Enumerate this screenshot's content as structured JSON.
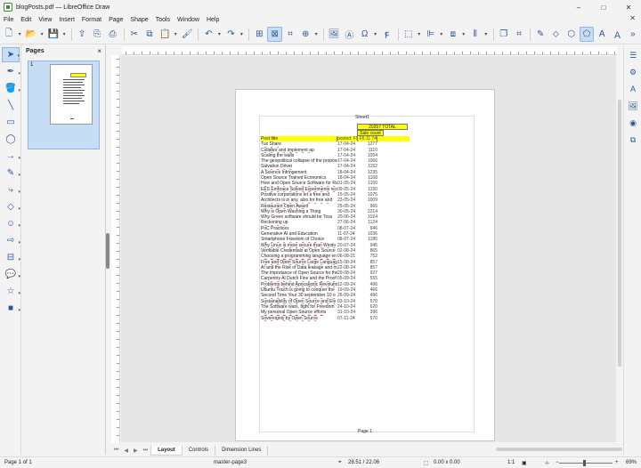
{
  "window": {
    "title": "blogPosts.pdf — LibreOffice Draw",
    "minimize": "–",
    "maximize": "□",
    "close": "✕"
  },
  "menu": [
    "File",
    "Edit",
    "View",
    "Insert",
    "Format",
    "Page",
    "Shape",
    "Tools",
    "Window",
    "Help"
  ],
  "menu_close_doc": "✕",
  "pages_panel": {
    "title": "Pages",
    "close": "×",
    "page_number": "1"
  },
  "canvas": {
    "sheet_title": "Sheet1",
    "header": {
      "total_label": "2025? TOTAL",
      "sales_count": "Sale count",
      "col_title": "Post title",
      "col_date": "posted: F5",
      "col_value": "F6 11 74"
    },
    "rows": [
      [
        "Tux Share",
        "17-04-24",
        "1277"
      ],
      [
        "Collabor and implement ap",
        "17-04-24",
        "1110"
      ],
      [
        "Scaling the walls",
        "17-04-24",
        "1054"
      ],
      [
        "The geopolitical collapse of the propose",
        "17-04-24",
        "1066"
      ],
      [
        "Salvation Driver",
        "17-04-24",
        "1152"
      ],
      [
        "A Science Infringement",
        "18-04-24",
        "1235"
      ],
      [
        "Open Source Trained Economics",
        "18-04-24",
        "1168"
      ],
      [
        "How and Open Source Software for Ru",
        "01-05-24",
        "1150"
      ],
      [
        "EES Embrace Solved Experiments resu",
        "09-05-24",
        "1150"
      ],
      [
        "Positive corporations let a free and",
        "15-05-24",
        "1075"
      ],
      [
        "Architects is in any, also for free and",
        "23-05-24",
        "1009"
      ],
      [
        "Restaurant Open Award",
        "25-05-24",
        "966"
      ],
      [
        "Why is Open Washing a Thing",
        "30-05-24",
        "2214"
      ],
      [
        "Why Green software should be Toss",
        "20-06-24",
        "1024"
      ],
      [
        "Reckoning up",
        "27-06-24",
        "1124"
      ],
      [
        "PoC Practices",
        "08-07-24",
        "946"
      ],
      [
        "Generative AI and Education",
        "11-07-24",
        "1036"
      ],
      [
        "Smartphone Freedom of Choice",
        "08-07-24",
        "1185"
      ],
      [
        "Why Linux is more secure than Windo",
        "20-07-24",
        "945"
      ],
      [
        "Verifiable Credentials at Open Source",
        "02-08-24",
        "865"
      ],
      [
        "Choosing a programming language en",
        "06-08-21",
        "752"
      ],
      [
        "Free and Open Source Large Language",
        "15-08-24",
        "857"
      ],
      [
        "AI and the Risk of Data leakage and m",
        "22-08-24",
        "857"
      ],
      [
        "The importance of Open Source for the",
        "29-08-24",
        "927"
      ],
      [
        "Carpentry AI Dutch Fine and the Proof",
        "05-09-24",
        "555"
      ],
      [
        "Problems behind Apocalyptic Revolution",
        "12-09-24",
        "496"
      ],
      [
        "Ubuntu Touch is going to conquer the",
        "19-09-24",
        "466"
      ],
      [
        "Second Time Your 30 september 10 o",
        "26-09-24",
        "496"
      ],
      [
        "Sustainability of Open Source and Ele",
        "03-10-24",
        "570"
      ],
      [
        "The Software wars, fight for Freedom",
        "24-10-24",
        "620"
      ],
      [
        "My personal Open Source efforts",
        "31-10-24",
        "396"
      ],
      [
        "Sovereignty by Open Source",
        "07-11-24",
        "570"
      ]
    ],
    "page_label": "Page 1"
  },
  "tabs": {
    "nav": [
      "⏮",
      "◀",
      "▶",
      "⏭"
    ],
    "items": [
      "Layout",
      "Controls",
      "Dimension Lines"
    ]
  },
  "status": {
    "page": "Page 1 of 1",
    "master": "master-page3",
    "position": "28.51 / 22.06",
    "size": "0.00 x 0.00",
    "scale": "1:1",
    "zoom": "69%",
    "zoom_level": 0.45
  }
}
